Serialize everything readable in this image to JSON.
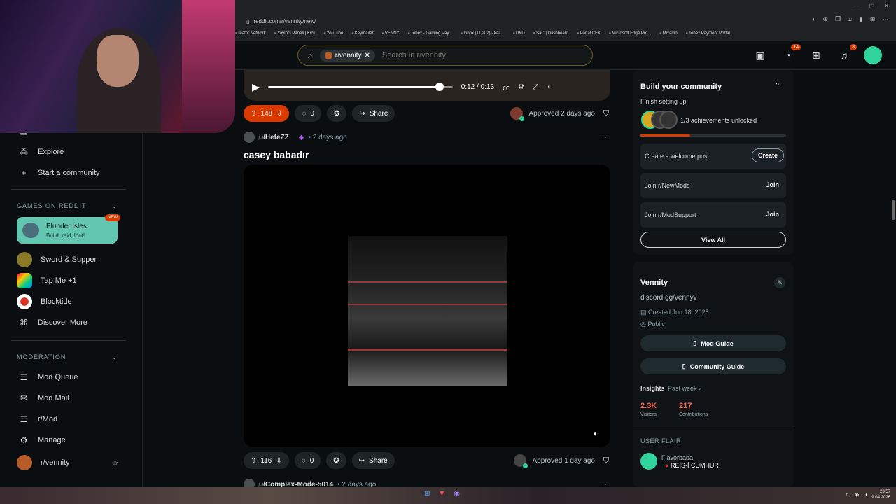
{
  "browser": {
    "url": "reddit.com/r/vennity/new/",
    "bookmarks": [
      "reator Network",
      "Yayıncı Paneli | Kick",
      "YouTube",
      "Keymailer",
      "VENNY",
      "Tebex - Gaming Pay...",
      "Inbox (11,202) - kaa...",
      "D&D",
      "SaC | Dashboard",
      "Portal CFX",
      "Microsoft Edge Pro...",
      "Mixamo",
      "Tebex Payment Portal"
    ]
  },
  "header": {
    "search_chip": "r/vennity",
    "search_placeholder": "Search in r/vennity",
    "chat_badge": "14",
    "notif_badge": "3"
  },
  "sidebar": {
    "top_items": [
      {
        "label": "News",
        "icon": "news-icon"
      },
      {
        "label": "Explore",
        "icon": "explore-icon"
      },
      {
        "label": "Start a community",
        "icon": "plus-icon"
      }
    ],
    "games_header": "GAMES ON REDDIT",
    "game_card": {
      "name": "Plunder Isles",
      "desc": "Build, raid, loot!",
      "badge": "NEW"
    },
    "games": [
      "Sword & Supper",
      "Tap Me +1",
      "Blocktide",
      "Discover More"
    ],
    "moderation_header": "MODERATION",
    "moderation": [
      "Mod Queue",
      "Mod Mail",
      "r/Mod",
      "Manage",
      "r/vennity"
    ]
  },
  "video_player": {
    "time": "0:12 / 0:13",
    "progress": 0.93
  },
  "posts": [
    {
      "votes": "148",
      "comments": "0",
      "share": "Share",
      "approved": "Approved 2 days ago"
    },
    {
      "user": "u/HefeZZ",
      "time": "• 2 days ago",
      "title": "casey babadır",
      "votes": "116",
      "comments": "0",
      "share": "Share",
      "approved": "Approved 1 day ago"
    },
    {
      "user": "u/Complex-Mode-5014",
      "time": "• 2 days ago"
    }
  ],
  "right_panel": {
    "build_title": "Build your community",
    "finish": "Finish setting up",
    "achievements": "1/3 achievements unlocked",
    "achievement_progress": 0.34,
    "tasks": [
      {
        "label": "Create a welcome post",
        "action": "Create"
      },
      {
        "label": "Join r/NewMods",
        "action": "Join"
      },
      {
        "label": "Join r/ModSupport",
        "action": "Join"
      }
    ],
    "view_all": "View All",
    "community_name": "Vennity",
    "community_desc": "discord.gg/vennyv",
    "created": "Created Jun 18, 2025",
    "visibility": "Public",
    "mod_guide": "Mod Guide",
    "community_guide": "Community Guide",
    "insights": "Insights",
    "insights_period": "Past week ›",
    "visitors_num": "2.3K",
    "visitors_lbl": "Visitors",
    "contrib_num": "217",
    "contrib_lbl": "Contributions",
    "user_flair_header": "USER FLAIR",
    "flair_user": "Flavorbaba",
    "flair_text": "REİS-İ CUMHUR"
  },
  "taskbar": {
    "time": "23:57",
    "date": "9.04.2026"
  },
  "colors": {
    "accent": "#d93a00",
    "bg": "#0b0e10",
    "teal": "#63c6b0"
  }
}
